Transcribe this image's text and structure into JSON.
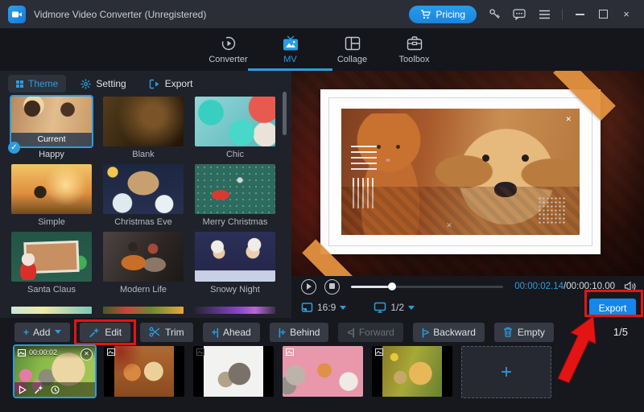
{
  "titlebar": {
    "title": "Vidmore Video Converter (Unregistered)",
    "pricing_label": "Pricing"
  },
  "nav": {
    "tabs": [
      {
        "label": "Converter"
      },
      {
        "label": "MV"
      },
      {
        "label": "Collage"
      },
      {
        "label": "Toolbox"
      }
    ]
  },
  "panel": {
    "tabs": [
      {
        "label": "Theme"
      },
      {
        "label": "Setting"
      },
      {
        "label": "Export"
      }
    ],
    "themes": [
      {
        "name": "Happy",
        "badge": "Current"
      },
      {
        "name": "Blank"
      },
      {
        "name": "Chic"
      },
      {
        "name": "Simple"
      },
      {
        "name": "Christmas Eve"
      },
      {
        "name": "Merry Christmas"
      },
      {
        "name": "Santa Claus"
      },
      {
        "name": "Modern Life"
      },
      {
        "name": "Snowy Night"
      }
    ]
  },
  "preview": {
    "time_current": "00:00:02.14",
    "time_separator": "/",
    "time_total": "00:00:10.00",
    "aspect_ratio": "16:9",
    "display_scale": "1/2",
    "export_label": "Export",
    "progress_percent": 27
  },
  "toolbar": {
    "buttons": [
      {
        "label": "Add"
      },
      {
        "label": "Edit"
      },
      {
        "label": "Trim"
      },
      {
        "label": "Ahead"
      },
      {
        "label": "Behind"
      },
      {
        "label": "Forward"
      },
      {
        "label": "Backward"
      },
      {
        "label": "Empty"
      }
    ],
    "counter": "1/5"
  },
  "timeline": {
    "selected_clip_time": "00:00:02"
  },
  "colors": {
    "accent_blue": "#2a9de0",
    "export_button": "#1687e8",
    "annotation_red": "#e41414"
  }
}
